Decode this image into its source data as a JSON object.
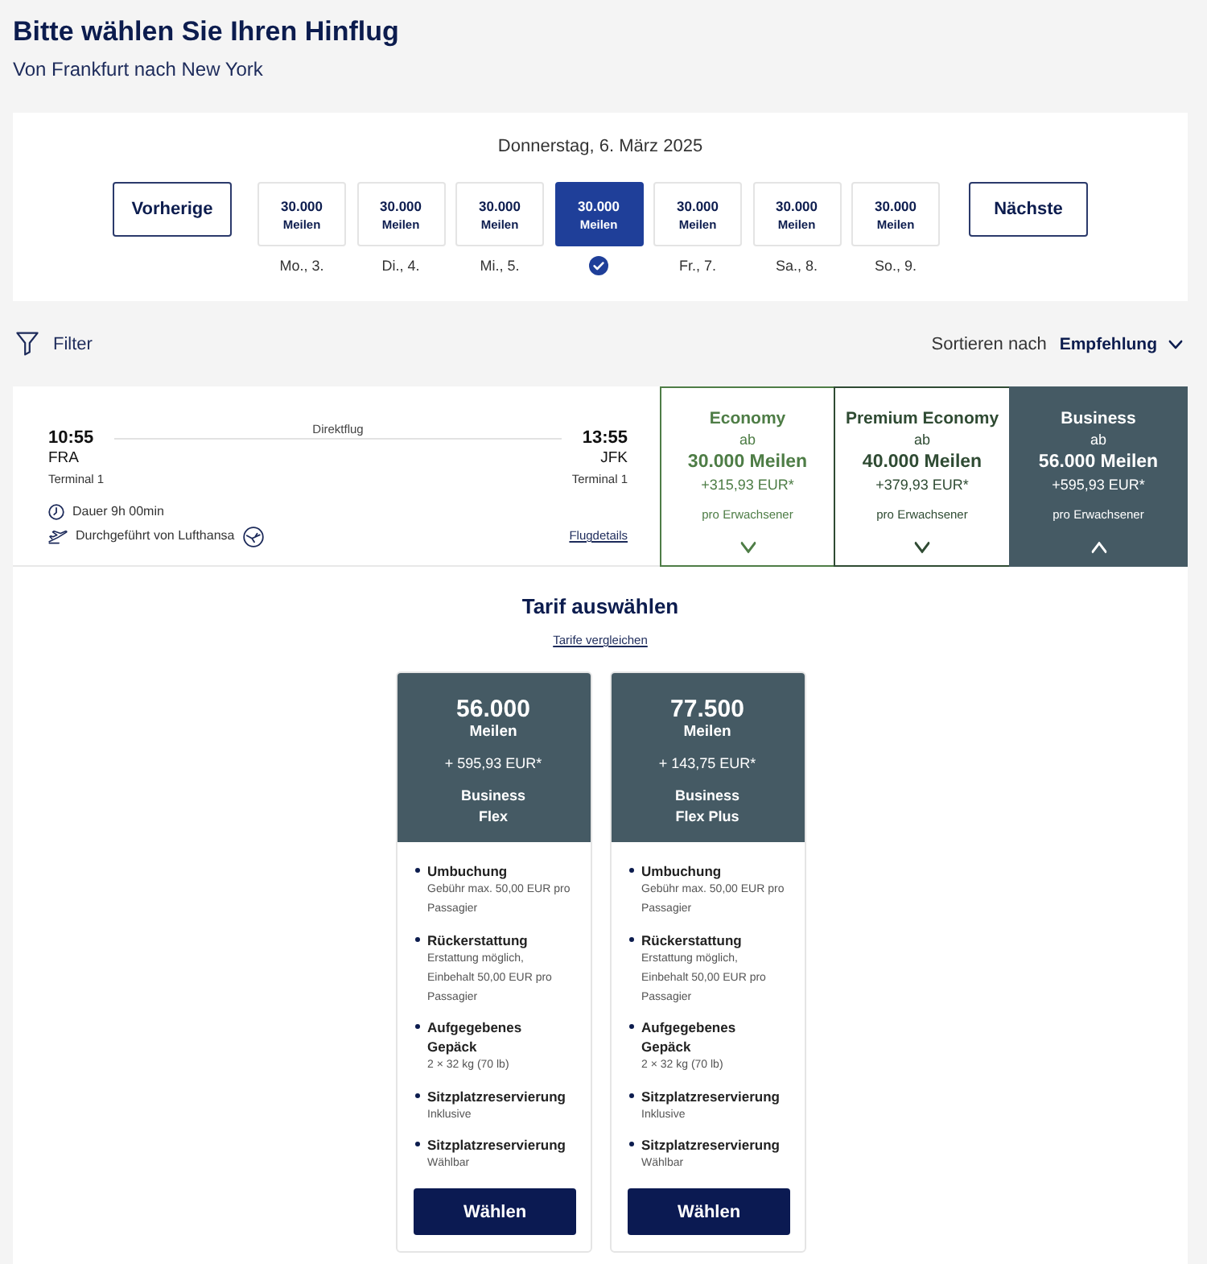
{
  "header": {
    "title": "Bitte wählen Sie Ihren Hinflug",
    "subtitle": "Von Frankfurt nach New York"
  },
  "date_selector": {
    "date": "Donnerstag, 6. März 2025",
    "previous": "Vorherige",
    "next": "Nächste",
    "days": [
      {
        "miles": "30.000",
        "unit": "Meilen",
        "label": "Mo., 3.",
        "selected": false
      },
      {
        "miles": "30.000",
        "unit": "Meilen",
        "label": "Di., 4.",
        "selected": false
      },
      {
        "miles": "30.000",
        "unit": "Meilen",
        "label": "Mi., 5.",
        "selected": false
      },
      {
        "miles": "30.000",
        "unit": "Meilen",
        "selected": true
      },
      {
        "miles": "30.000",
        "unit": "Meilen",
        "label": "Fr., 7.",
        "selected": false
      },
      {
        "miles": "30.000",
        "unit": "Meilen",
        "label": "Sa., 8.",
        "selected": false
      },
      {
        "miles": "30.000",
        "unit": "Meilen",
        "label": "So., 9.",
        "selected": false
      }
    ]
  },
  "toolbar": {
    "filter": "Filter",
    "sort_label": "Sortieren nach",
    "sort_value": "Empfehlung"
  },
  "flight": {
    "type": "Direktflug",
    "departure": {
      "time": "10:55",
      "airport": "FRA",
      "terminal": "Terminal 1"
    },
    "arrival": {
      "time": "13:55",
      "airport": "JFK",
      "terminal": "Terminal 1"
    },
    "duration": "Dauer 9h 00min",
    "operator": "Durchgeführt von Lufthansa",
    "details_link": "Flugdetails",
    "cabins": [
      {
        "name": "Economy",
        "from": "ab",
        "miles": "30.000 Meilen",
        "price": "+315,93 EUR*",
        "per": "pro Erwachsener",
        "color": "#4e7d46",
        "selected": false
      },
      {
        "name": "Premium Economy",
        "from": "ab",
        "miles": "40.000 Meilen",
        "price": "+379,93 EUR*",
        "per": "pro Erwachsener",
        "color": "#2f4b33",
        "selected": false
      },
      {
        "name": "Business",
        "from": "ab",
        "miles": "56.000 Meilen",
        "price": "+595,93 EUR*",
        "per": "pro Erwachsener",
        "color": "#455a64",
        "selected": true
      }
    ]
  },
  "fares": {
    "title": "Tarif auswählen",
    "compare_link": "Tarife vergleichen",
    "cards": [
      {
        "miles": "56.000",
        "unit": "Meilen",
        "price": "+ 595,93 EUR*",
        "name": "Business Flex",
        "features": [
          {
            "title": "Umbuchung",
            "detail": "Gebühr max. 50,00 EUR pro Passagier"
          },
          {
            "title": "Rückerstattung",
            "detail": "Erstattung möglich, Einbehalt 50,00 EUR pro Passagier"
          },
          {
            "title": "Aufgegebenes Gepäck",
            "detail": "2 × 32 kg (70 lb)"
          },
          {
            "title": "Sitzplatzreservierung",
            "detail": "Inklusive"
          },
          {
            "title": "Sitzplatzreservierung",
            "detail": "Wählbar"
          }
        ],
        "button": "Wählen"
      },
      {
        "miles": "77.500",
        "unit": "Meilen",
        "price": "+ 143,75 EUR*",
        "name": "Business Flex Plus",
        "features": [
          {
            "title": "Umbuchung",
            "detail": "Gebühr max. 50,00 EUR pro Passagier"
          },
          {
            "title": "Rückerstattung",
            "detail": "Erstattung möglich, Einbehalt 50,00 EUR pro Passagier"
          },
          {
            "title": "Aufgegebenes Gepäck",
            "detail": "2 × 32 kg (70 lb)"
          },
          {
            "title": "Sitzplatzreservierung",
            "detail": "Inklusive"
          },
          {
            "title": "Sitzplatzreservierung",
            "detail": "Wählbar"
          }
        ],
        "button": "Wählen"
      }
    ]
  }
}
